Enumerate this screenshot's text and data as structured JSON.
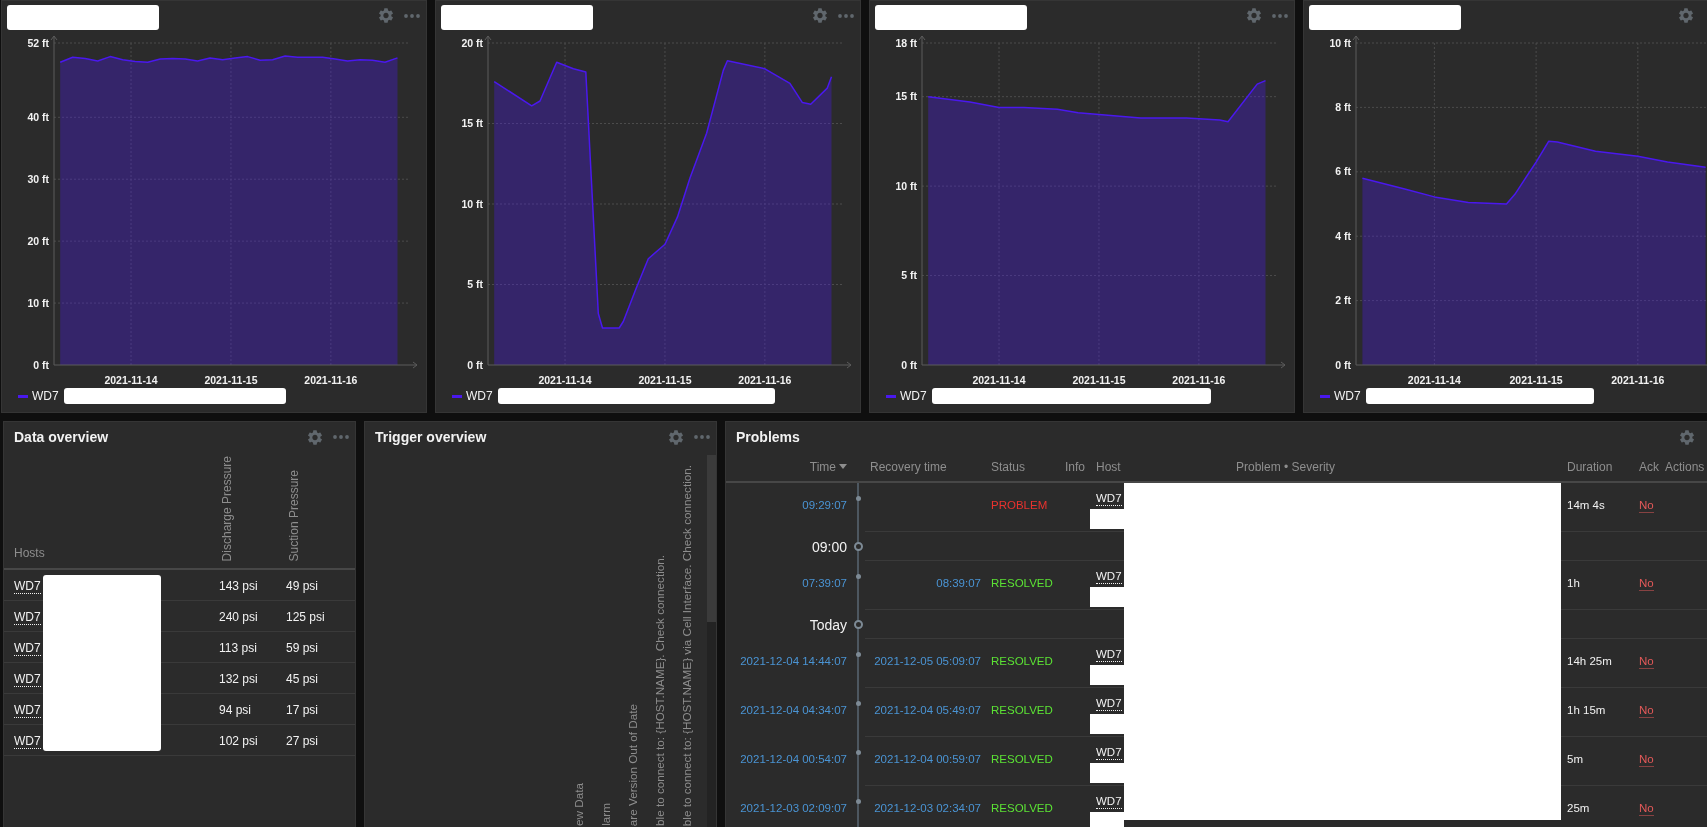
{
  "graph_widgets": [
    {
      "title_redacted": true,
      "legend_redacted": true,
      "chart_data": {
        "type": "area",
        "grid": true,
        "x": [
          "2021-11-13 07:00",
          "2021-11-13 10:00",
          "2021-11-13 13:00",
          "2021-11-13 16:00",
          "2021-11-13 19:00",
          "2021-11-13 22:00",
          "2021-11-14 01:00",
          "2021-11-14 04:00",
          "2021-11-14 07:00",
          "2021-11-14 10:00",
          "2021-11-14 13:00",
          "2021-11-14 16:00",
          "2021-11-14 19:00",
          "2021-11-14 22:00",
          "2021-11-15 01:00",
          "2021-11-15 04:00",
          "2021-11-15 07:00",
          "2021-11-15 10:00",
          "2021-11-15 13:00",
          "2021-11-15 16:00",
          "2021-11-15 19:00",
          "2021-11-15 22:00",
          "2021-11-16 01:00",
          "2021-11-16 04:00",
          "2021-11-16 07:00",
          "2021-11-16 10:00",
          "2021-11-16 13:00",
          "2021-11-16 16:00"
        ],
        "series": [
          {
            "name": "WD7",
            "color": "#4a18ee",
            "values": [
              48.9,
              49.7,
              49.5,
              49.1,
              49.8,
              49.3,
              49.0,
              48.9,
              49.4,
              49.5,
              49.4,
              49.1,
              49.6,
              49.3,
              49.6,
              49.8,
              49.2,
              49.3,
              49.9,
              49.7,
              49.7,
              49.7,
              49.4,
              49.1,
              49.3,
              49.2,
              48.9,
              49.6
            ]
          }
        ],
        "xlim": [
          "2021-11-13 05:30",
          "2021-11-16 19:00"
        ],
        "ylim": [
          0,
          52
        ],
        "xticks": [
          {
            "value": "2021-11-14 00:00",
            "label": "2021-11-14"
          },
          {
            "value": "2021-11-15 00:00",
            "label": "2021-11-15"
          },
          {
            "value": "2021-11-16 00:00",
            "label": "2021-11-16"
          }
        ],
        "yticks": [
          {
            "value": 0,
            "label": "0 ft"
          },
          {
            "value": 10,
            "label": "10 ft"
          },
          {
            "value": 20,
            "label": "20 ft"
          },
          {
            "value": 30,
            "label": "30 ft"
          },
          {
            "value": 40,
            "label": "40 ft"
          },
          {
            "value": 52,
            "label": "52 ft"
          }
        ]
      }
    },
    {
      "title_redacted": true,
      "legend_redacted": true,
      "chart_data": {
        "type": "area",
        "grid": true,
        "x": [
          "2021-11-13 07:00",
          "2021-11-13 16:00",
          "2021-11-13 18:00",
          "2021-11-13 22:00",
          "2021-11-14 00:00",
          "2021-11-14 02:00",
          "2021-11-14 05:00",
          "2021-11-14 08:00",
          "2021-11-14 09:00",
          "2021-11-14 13:00",
          "2021-11-14 14:00",
          "2021-11-14 17:00",
          "2021-11-14 20:00",
          "2021-11-15 00:00",
          "2021-11-15 03:00",
          "2021-11-15 06:00",
          "2021-11-15 10:00",
          "2021-11-15 14:00",
          "2021-11-15 15:00",
          "2021-11-16 00:00",
          "2021-11-16 06:00",
          "2021-11-16 09:00",
          "2021-11-16 11:00",
          "2021-11-16 15:00",
          "2021-11-16 16:00"
        ],
        "series": [
          {
            "name": "WD7",
            "color": "#4a18ee",
            "values": [
              17.6,
              16.1,
              16.4,
              18.8,
              18.6,
              18.4,
              18.2,
              3.2,
              2.3,
              2.3,
              2.7,
              4.7,
              6.6,
              7.5,
              9.2,
              11.6,
              14.4,
              18.3,
              18.9,
              18.4,
              17.5,
              16.3,
              16.2,
              17.2,
              17.9
            ]
          }
        ],
        "xlim": [
          "2021-11-13 05:30",
          "2021-11-16 19:00"
        ],
        "ylim": [
          0,
          20
        ],
        "xticks": [
          {
            "value": "2021-11-14 00:00",
            "label": "2021-11-14"
          },
          {
            "value": "2021-11-15 00:00",
            "label": "2021-11-15"
          },
          {
            "value": "2021-11-16 00:00",
            "label": "2021-11-16"
          }
        ],
        "yticks": [
          {
            "value": 0,
            "label": "0 ft"
          },
          {
            "value": 5,
            "label": "5 ft"
          },
          {
            "value": 10,
            "label": "10 ft"
          },
          {
            "value": 15,
            "label": "15 ft"
          },
          {
            "value": 20,
            "label": "20 ft"
          }
        ]
      }
    },
    {
      "title_redacted": true,
      "legend_redacted": true,
      "chart_data": {
        "type": "area",
        "grid": true,
        "x": [
          "2021-11-13 07:00",
          "2021-11-13 17:00",
          "2021-11-14 00:00",
          "2021-11-14 06:00",
          "2021-11-14 14:00",
          "2021-11-14 19:00",
          "2021-11-15 00:00",
          "2021-11-15 10:00",
          "2021-11-15 21:00",
          "2021-11-16 05:00",
          "2021-11-16 07:00",
          "2021-11-16 14:00",
          "2021-11-16 16:00"
        ],
        "series": [
          {
            "name": "WD7",
            "color": "#4a18ee",
            "values": [
              15.0,
              14.7,
              14.4,
              14.4,
              14.3,
              14.1,
              14.0,
              13.8,
              13.8,
              13.7,
              13.6,
              15.7,
              15.9
            ]
          }
        ],
        "xlim": [
          "2021-11-13 05:30",
          "2021-11-16 19:00"
        ],
        "ylim": [
          0,
          18
        ],
        "xticks": [
          {
            "value": "2021-11-14 00:00",
            "label": "2021-11-14"
          },
          {
            "value": "2021-11-15 00:00",
            "label": "2021-11-15"
          },
          {
            "value": "2021-11-16 00:00",
            "label": "2021-11-16"
          }
        ],
        "yticks": [
          {
            "value": 0,
            "label": "0 ft"
          },
          {
            "value": 5,
            "label": "5 ft"
          },
          {
            "value": 10,
            "label": "10 ft"
          },
          {
            "value": 15,
            "label": "15 ft"
          },
          {
            "value": 18,
            "label": "18 ft"
          }
        ]
      }
    },
    {
      "title_redacted": true,
      "legend_redacted": true,
      "chart_data": {
        "type": "area",
        "grid": true,
        "x": [
          "2021-11-13 07:00",
          "2021-11-13 17:00",
          "2021-11-14 00:00",
          "2021-11-14 08:00",
          "2021-11-14 17:00",
          "2021-11-14 19:00",
          "2021-11-15 00:00",
          "2021-11-15 03:00",
          "2021-11-15 05:00",
          "2021-11-15 14:00",
          "2021-11-16 00:00",
          "2021-11-16 07:00",
          "2021-11-16 16:00"
        ],
        "series": [
          {
            "name": "WD7",
            "color": "#4a18ee",
            "values": [
              5.8,
              5.47,
              5.22,
              5.05,
              5.0,
              5.3,
              6.3,
              6.95,
              6.93,
              6.64,
              6.48,
              6.3,
              6.14
            ]
          }
        ],
        "xlim": [
          "2021-11-13 05:30",
          "2021-11-16 17:30"
        ],
        "ylim": [
          0,
          10
        ],
        "xticks": [
          {
            "value": "2021-11-14 00:00",
            "label": "2021-11-14"
          },
          {
            "value": "2021-11-15 00:00",
            "label": "2021-11-15"
          },
          {
            "value": "2021-11-16 00:00",
            "label": "2021-11-16"
          }
        ],
        "yticks": [
          {
            "value": 0,
            "label": "0 ft"
          },
          {
            "value": 2,
            "label": "2 ft"
          },
          {
            "value": 4,
            "label": "4 ft"
          },
          {
            "value": 6,
            "label": "6 ft"
          },
          {
            "value": 8,
            "label": "8 ft"
          },
          {
            "value": 10,
            "label": "10 ft"
          }
        ]
      }
    }
  ],
  "data_overview": {
    "title": "Data overview",
    "columns": [
      "Hosts",
      "Discharge Pressure",
      "Suction Pressure"
    ],
    "hosts_redacted": true,
    "rows": [
      {
        "host": "WD7",
        "values": [
          "143 psi",
          "49 psi"
        ]
      },
      {
        "host": "WD7",
        "values": [
          "240 psi",
          "125 psi"
        ]
      },
      {
        "host": "WD7",
        "values": [
          "113 psi",
          "59 psi"
        ]
      },
      {
        "host": "WD7",
        "values": [
          "132 psi",
          "45 psi"
        ]
      },
      {
        "host": "WD7",
        "values": [
          "94 psi",
          "17 psi"
        ]
      },
      {
        "host": "WD7",
        "values": [
          "102 psi",
          "27 psi"
        ]
      }
    ]
  },
  "trigger_overview": {
    "title": "Trigger overview",
    "columns": [
      "ew Data",
      "larm",
      "are Version Out of Date",
      "ble to connect to: {HOST.NAME}. Check connection.",
      "ble to connect to: {HOST.NAME} via Cell Interface. Check connection."
    ]
  },
  "problems": {
    "title": "Problems",
    "columns": [
      {
        "label": "Time",
        "sorted": true
      },
      {
        "label": "Recovery time",
        "sorted": false
      },
      {
        "label": "Status",
        "sorted": false
      },
      {
        "label": "Info",
        "sorted": false
      },
      {
        "label": "Host",
        "sorted": false
      },
      {
        "label": "Problem • Severity",
        "sorted": false
      },
      {
        "label": "Duration",
        "sorted": false
      },
      {
        "label": "Ack",
        "sorted": false
      },
      {
        "label": "Actions",
        "sorted": false
      }
    ],
    "problem_column_redacted": true,
    "rows": [
      {
        "kind": "event",
        "time": "09:29:07",
        "status": {
          "label": "PROBLEM",
          "color": "#e8322e"
        },
        "host": {
          "label": "WD7",
          "redacted": true
        },
        "duration": "14m 4s",
        "ack": {
          "label": "No",
          "acknowledged": false
        }
      },
      {
        "kind": "divider",
        "label": "09:00"
      },
      {
        "kind": "event",
        "time": "07:39:07",
        "recovery_time": "08:39:07",
        "status": {
          "label": "RESOLVED",
          "color": "#5be234"
        },
        "host": {
          "label": "WD7",
          "redacted": true
        },
        "duration": "1h",
        "ack": {
          "label": "No",
          "acknowledged": false
        }
      },
      {
        "kind": "divider",
        "label": "Today"
      },
      {
        "kind": "event",
        "time": "2021-12-04 14:44:07",
        "recovery_time": "2021-12-05 05:09:07",
        "status": {
          "label": "RESOLVED",
          "color": "#5be234"
        },
        "host": {
          "label": "WD7",
          "redacted": true
        },
        "duration": "14h 25m",
        "ack": {
          "label": "No",
          "acknowledged": false
        }
      },
      {
        "kind": "event",
        "time": "2021-12-04 04:34:07",
        "recovery_time": "2021-12-04 05:49:07",
        "status": {
          "label": "RESOLVED",
          "color": "#5be234"
        },
        "host": {
          "label": "WD7",
          "redacted": true
        },
        "duration": "1h 15m",
        "ack": {
          "label": "No",
          "acknowledged": false
        }
      },
      {
        "kind": "event",
        "time": "2021-12-04 00:54:07",
        "recovery_time": "2021-12-04 00:59:07",
        "status": {
          "label": "RESOLVED",
          "color": "#5be234"
        },
        "host": {
          "label": "WD7",
          "redacted": true
        },
        "duration": "5m",
        "ack": {
          "label": "No",
          "acknowledged": false
        }
      },
      {
        "kind": "event",
        "time": "2021-12-03 02:09:07",
        "recovery_time": "2021-12-03 02:34:07",
        "status": {
          "label": "RESOLVED",
          "color": "#5be234"
        },
        "host": {
          "label": "WD7",
          "redacted": true
        },
        "duration": "25m",
        "ack": {
          "label": "No",
          "acknowledged": false
        }
      }
    ]
  }
}
